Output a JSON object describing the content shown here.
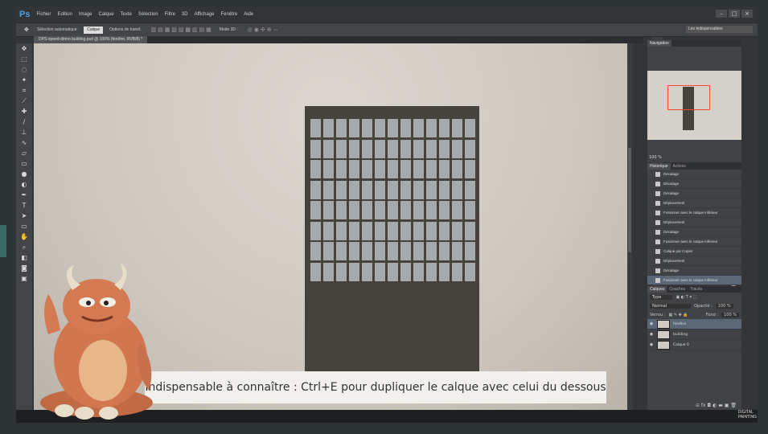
{
  "app": {
    "logo": "Ps"
  },
  "menu": [
    "Fichier",
    "Edition",
    "Image",
    "Calque",
    "Texte",
    "Sélection",
    "Filtre",
    "3D",
    "Affichage",
    "Fenêtre",
    "Aide"
  ],
  "options": {
    "auto_select_label": "Sélection automatique :",
    "auto_select_value": "Calque",
    "transform_label": "Options de transf.",
    "mode3d_label": "Mode 3D :",
    "workspace": "Les indispensables"
  },
  "doc_tab": "DPS-speed-démo building.psd @ 100% (fenêtre, RVB/8) *",
  "navigator": {
    "tab_nav": "Navigation",
    "zoom": "100 %"
  },
  "history": {
    "tab_history": "Historique",
    "tab_actions": "Actions",
    "items": [
      "Décalage",
      "Décalage",
      "Décalage",
      "Déplacement",
      "Fusionner avec le calque inférieur",
      "Déplacement",
      "Décalage",
      "Fusionner avec le calque inférieur",
      "Calque par Copier",
      "Déplacement",
      "Décalage",
      "Fusionner avec le calque inférieur"
    ]
  },
  "layers": {
    "tab_layers": "Calques",
    "tab_channels": "Couches",
    "tab_paths": "Tracés",
    "filter": "Type",
    "blend": "Normal",
    "opacity_label": "Opacité :",
    "opacity": "100 %",
    "lock_label": "Verrou :",
    "fill_label": "Fond :",
    "fill": "100 %",
    "items": [
      "fenêtre",
      "building",
      "Calque 0"
    ]
  },
  "caption": "Indispensable à connaître : Ctrl+E pour dupliquer le calque avec celui du dessous",
  "logo_text": [
    "DIGITAL",
    "PAINTING"
  ]
}
